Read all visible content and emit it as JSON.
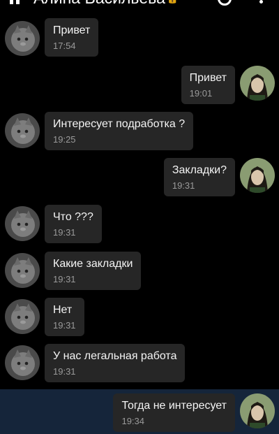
{
  "header": {
    "contact_name": "Алина Васильева",
    "status_badge": "🔒"
  },
  "messages": [
    {
      "text": "Привет",
      "time": "17:54",
      "side": "left"
    },
    {
      "text": "Привет",
      "time": "19:01",
      "side": "right"
    },
    {
      "text": "Интересует подработка ?",
      "time": "19:25",
      "side": "left"
    },
    {
      "text": "Закладки?",
      "time": "19:31",
      "side": "right"
    },
    {
      "text": "Что ???",
      "time": "19:31",
      "side": "left"
    },
    {
      "text": "Какие закладки",
      "time": "19:31",
      "side": "left"
    },
    {
      "text": "Нет",
      "time": "19:31",
      "side": "left"
    },
    {
      "text": "У нас легальная работа",
      "time": "19:31",
      "side": "left"
    },
    {
      "text": "Тогда не интересует",
      "time": "19:34",
      "side": "right",
      "highlighted": true
    }
  ],
  "colors": {
    "background": "#000000",
    "bubble": "#262626",
    "highlight_row": "#15253a",
    "time_text": "#9a9a9a"
  }
}
